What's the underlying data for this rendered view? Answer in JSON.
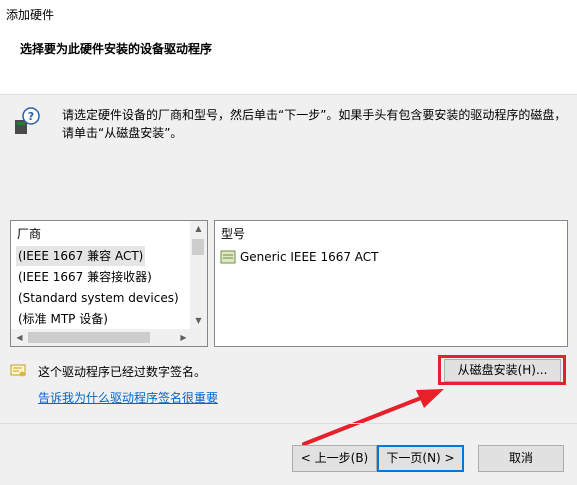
{
  "window": {
    "title": "添加硬件"
  },
  "header": {
    "heading": "选择要为此硬件安装的设备驱动程序"
  },
  "instruction": "请选定硬件设备的厂商和型号，然后单击“下一步”。如果手头有包含要安装的驱动程序的磁盘，请单击“从磁盘安装”。",
  "manufacturer_list": {
    "header": "厂商",
    "items": [
      "(IEEE 1667 兼容 ACT)",
      "(IEEE 1667 兼容接收器)",
      "(Standard system devices)",
      "(标准 MTP 设备)"
    ],
    "selected_index": 0
  },
  "model_list": {
    "header": "型号",
    "items": [
      "Generic IEEE 1667 ACT"
    ]
  },
  "signature": {
    "status": "这个驱动程序已经过数字签名。",
    "link": "告诉我为什么驱动程序签名很重要"
  },
  "buttons": {
    "have_disk": "从磁盘安装(H)...",
    "back": "< 上一步(B)",
    "next": "下一页(N) >",
    "cancel": "取消"
  },
  "colors": {
    "highlight": "#e8202a",
    "link": "#0066cc",
    "focus": "#0078d7"
  },
  "icons": [
    "hardware-help-icon",
    "device-icon",
    "certificate-icon",
    "red-arrow"
  ]
}
